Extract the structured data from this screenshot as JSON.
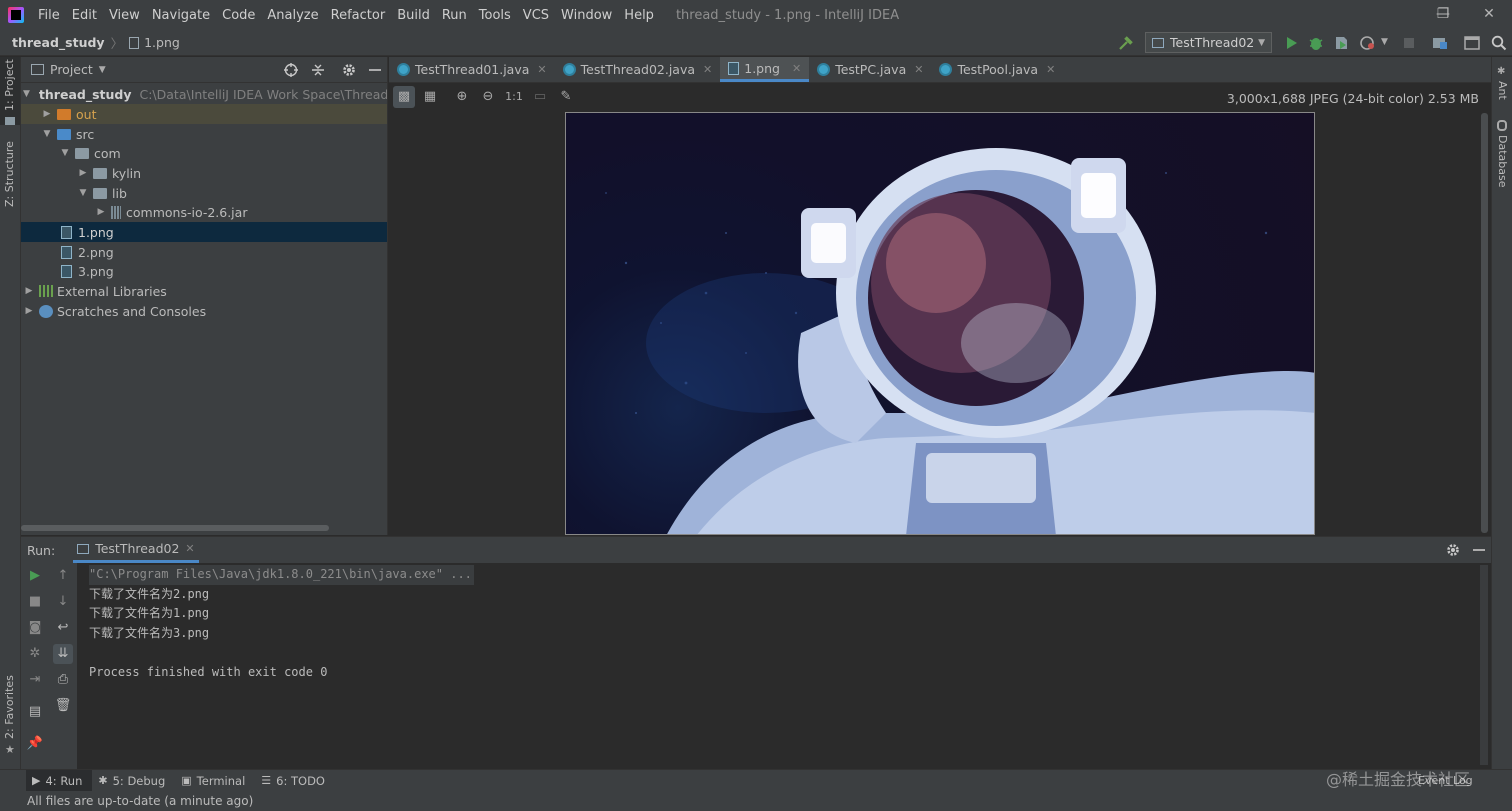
{
  "menubar": {
    "items": [
      "File",
      "Edit",
      "View",
      "Navigate",
      "Code",
      "Analyze",
      "Refactor",
      "Build",
      "Run",
      "Tools",
      "VCS",
      "Window",
      "Help"
    ],
    "window_title": "thread_study - 1.png - IntelliJ IDEA",
    "minimize": "—",
    "restore": "❐",
    "close": "✕"
  },
  "navbar": {
    "project": "thread_study",
    "separator": "〉",
    "file": "1.png",
    "run_config": "TestThread02"
  },
  "left_stripe": {
    "project_tab": "1: Project",
    "structure_tab": "Z: Structure",
    "favorites_tab": "2: Favorites"
  },
  "right_stripe": {
    "ant_tab": "Ant",
    "database_tab": "Database"
  },
  "project_panel": {
    "title": "Project",
    "tree": [
      {
        "label": "thread_study",
        "path": "C:\\Data\\IntelliJ IDEA Work Space\\Thread\\th",
        "arrow": "▼"
      },
      {
        "label": "out",
        "arrow": "▶"
      },
      {
        "label": "src",
        "arrow": "▼"
      },
      {
        "label": "com",
        "arrow": "▼"
      },
      {
        "label": "kylin",
        "arrow": "▶"
      },
      {
        "label": "lib",
        "arrow": "▼"
      },
      {
        "label": "commons-io-2.6.jar",
        "arrow": "▶"
      },
      {
        "label": "1.png"
      },
      {
        "label": "2.png"
      },
      {
        "label": "3.png"
      },
      {
        "label": "External Libraries",
        "arrow": "▶"
      },
      {
        "label": "Scratches and Consoles",
        "arrow": "▶"
      }
    ]
  },
  "editor": {
    "tabs": [
      {
        "label": "TestThread01.java",
        "close": "✕"
      },
      {
        "label": "TestThread02.java",
        "close": "✕"
      },
      {
        "label": "1.png",
        "close": "✕"
      },
      {
        "label": "TestPC.java",
        "close": "✕"
      },
      {
        "label": "TestPool.java",
        "close": "✕"
      }
    ],
    "image_toolbar": {
      "actual_size": "1:1"
    },
    "image_info": "3,000x1,688 JPEG (24-bit color) 2.53 MB"
  },
  "run_panel": {
    "label": "Run:",
    "tab": "TestThread02",
    "tab_close": "✕",
    "console": [
      "\"C:\\Program Files\\Java\\jdk1.8.0_221\\bin\\java.exe\" ...",
      "下载了文件名为2.png",
      "下载了文件名为1.png",
      "下载了文件名为3.png",
      "",
      "Process finished with exit code 0"
    ]
  },
  "bottom_bar": {
    "tabs": [
      {
        "label": "4: Run"
      },
      {
        "label": "5: Debug"
      },
      {
        "label": "Terminal"
      },
      {
        "label": "6: TODO"
      }
    ],
    "event_log": "Event Log",
    "watermark": "@稀土掘金技术社区"
  },
  "status": "All files are up-to-date (a minute ago)"
}
